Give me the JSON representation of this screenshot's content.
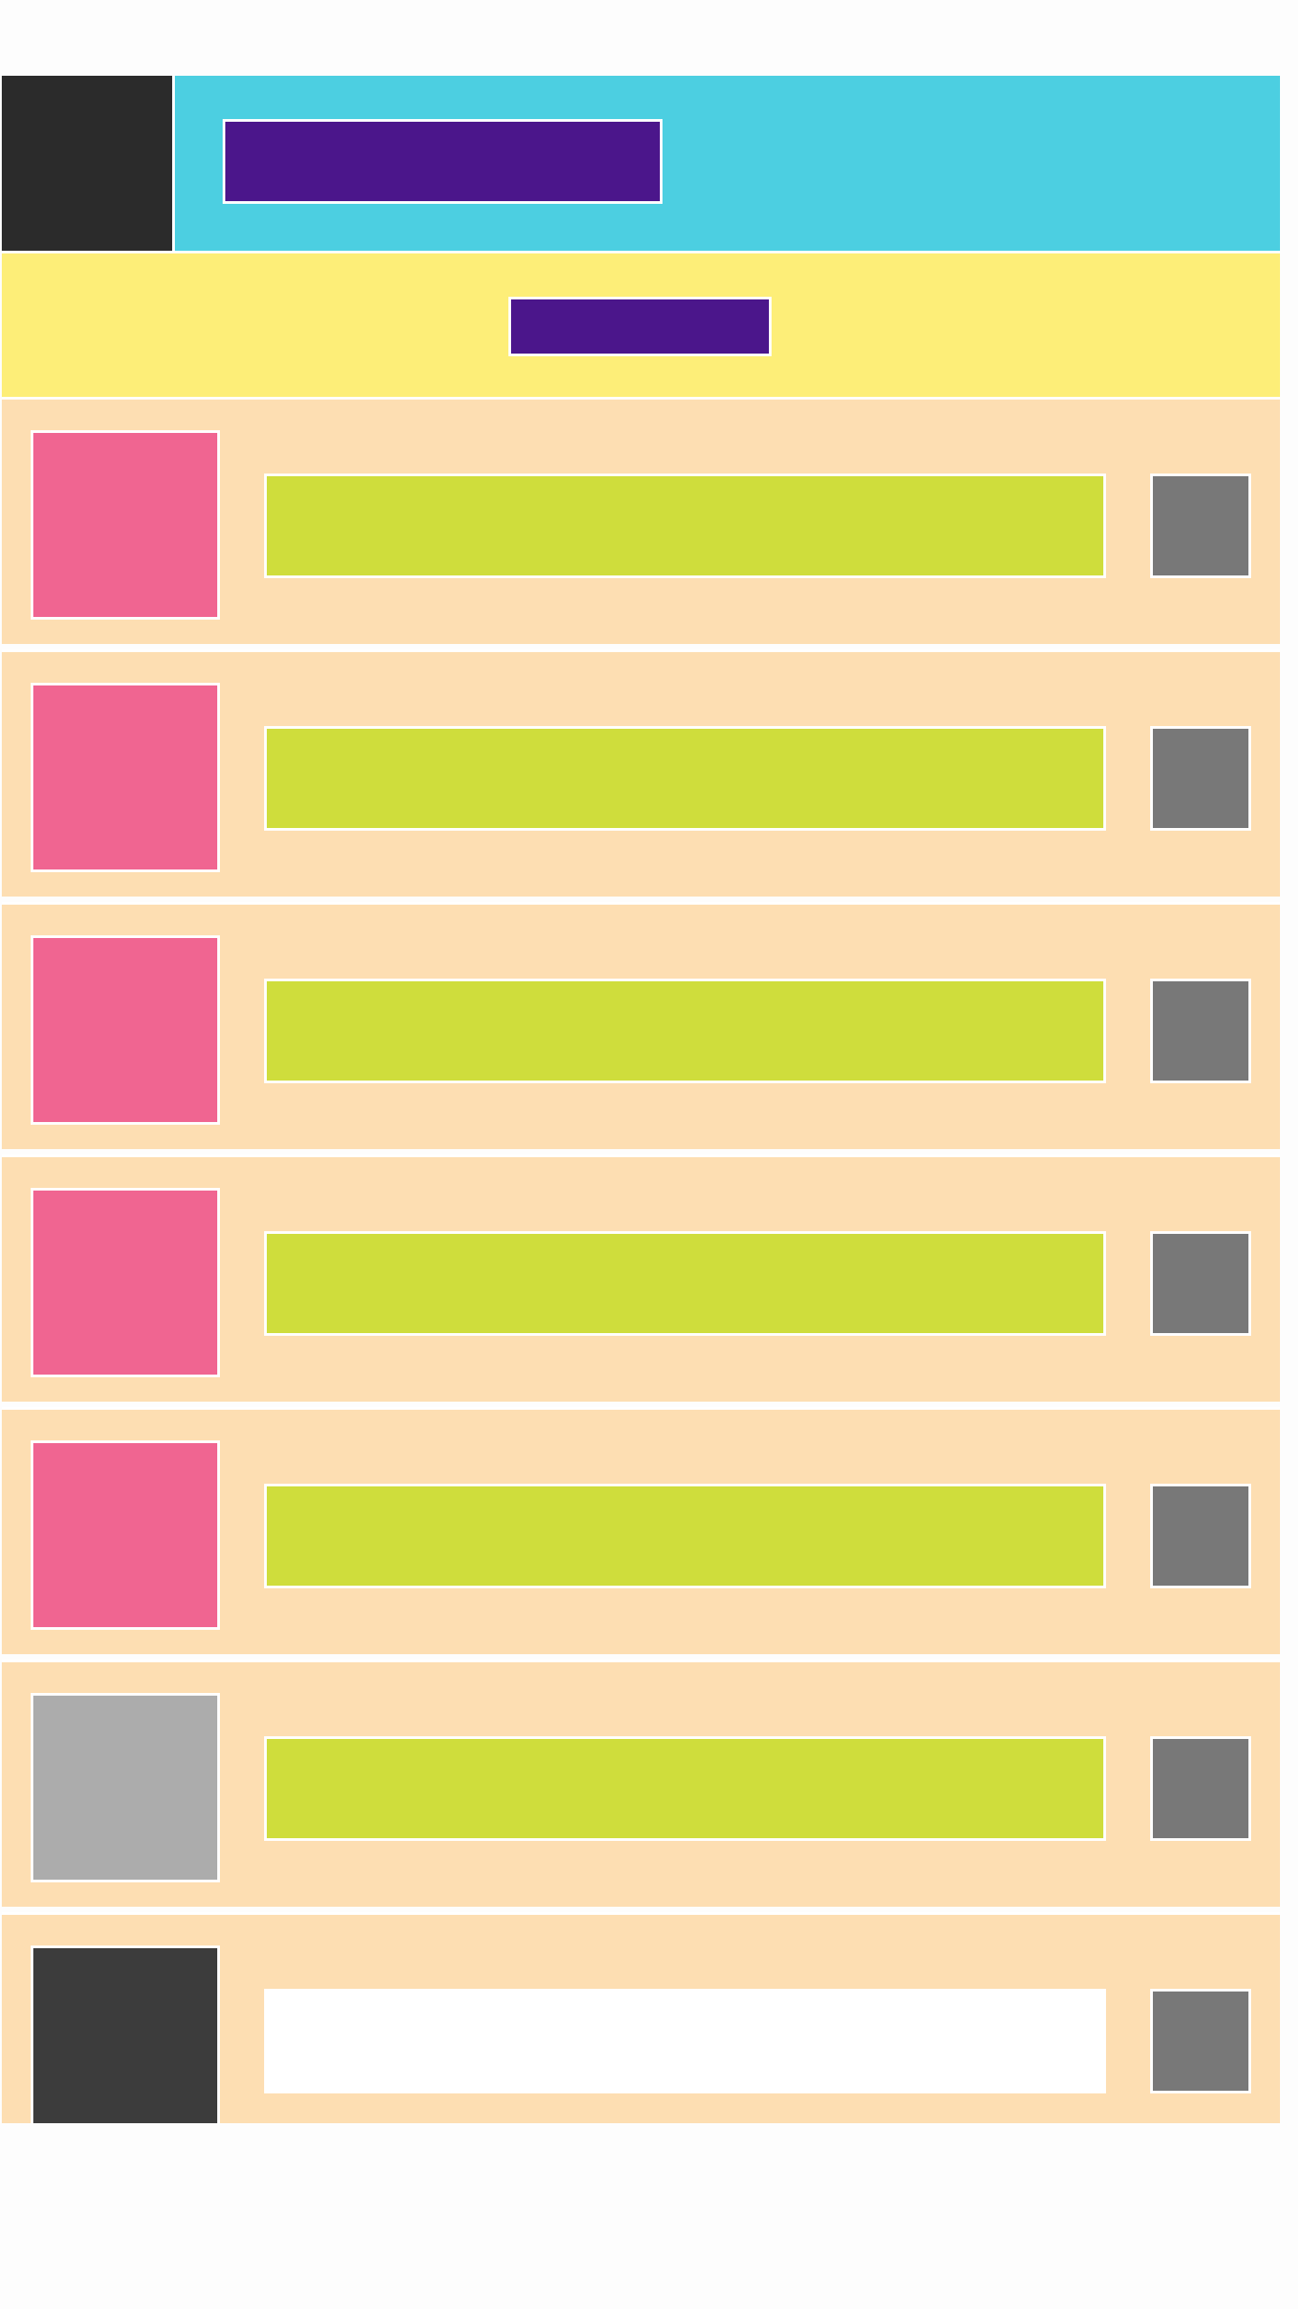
{
  "header": {
    "title": "",
    "subtitle": ""
  },
  "colors": {
    "menu_block": "#2b2b2b",
    "header_bar": "#4ccfe1",
    "title_block": "#4b168b",
    "subheader_bar": "#fdee78",
    "row_background": "#fddeb2",
    "row_bar": "#cfdd3c",
    "row_action": "#787878"
  },
  "list": {
    "items": [
      {
        "label": "",
        "thumb_color": "#f06591",
        "bar_color": "#cfdd3c"
      },
      {
        "label": "",
        "thumb_color": "#f06591",
        "bar_color": "#cfdd3c"
      },
      {
        "label": "",
        "thumb_color": "#f06591",
        "bar_color": "#cfdd3c"
      },
      {
        "label": "",
        "thumb_color": "#f06591",
        "bar_color": "#cfdd3c"
      },
      {
        "label": "",
        "thumb_color": "#f06591",
        "bar_color": "#cfdd3c"
      },
      {
        "label": "",
        "thumb_color": "#acacac",
        "bar_color": "#cfdd3c"
      },
      {
        "label": "",
        "thumb_color": "#3c3c3c",
        "bar_color": "#ffffff"
      }
    ]
  }
}
